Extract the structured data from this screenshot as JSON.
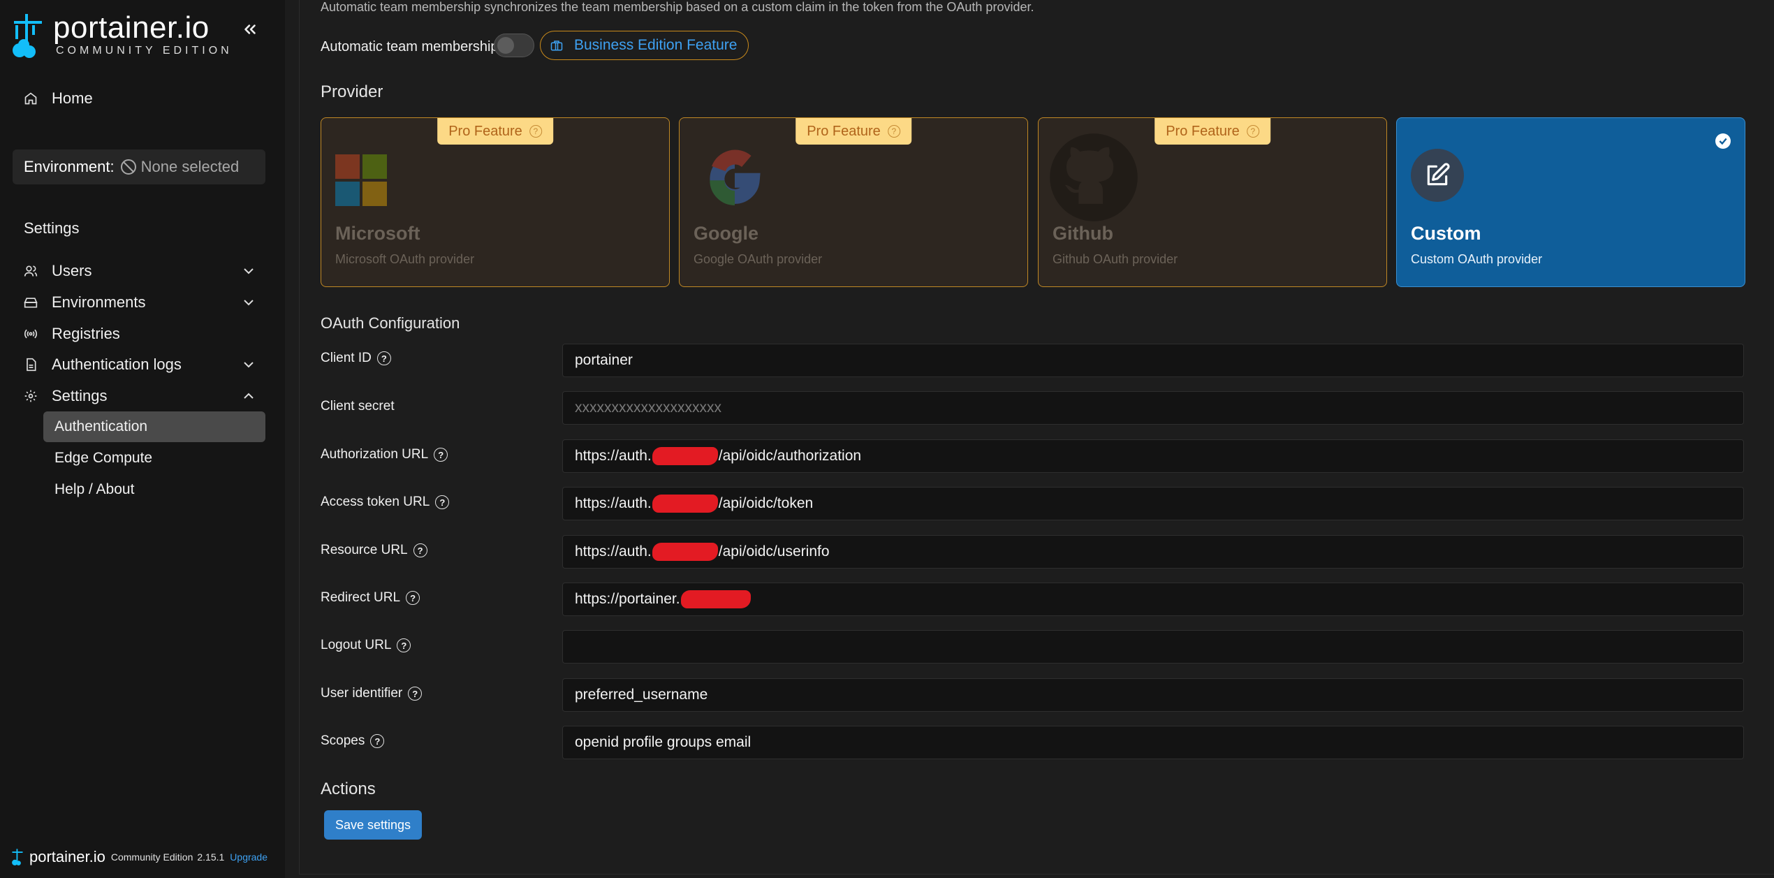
{
  "sidebar": {
    "logo_name": "portainer.io",
    "logo_sub": "COMMUNITY EDITION",
    "home": "Home",
    "environment_label": "Environment:",
    "environment_value": "None selected",
    "section_title": "Settings",
    "items": {
      "users": "Users",
      "environments": "Environments",
      "registries": "Registries",
      "auth_logs": "Authentication logs",
      "settings": "Settings"
    },
    "sub_items": {
      "authentication": "Authentication",
      "edge_compute": "Edge Compute",
      "help_about": "Help / About"
    },
    "footer": {
      "brand": "portainer.io",
      "edition": "Community Edition",
      "version": "2.15.1",
      "upgrade": "Upgrade"
    }
  },
  "main": {
    "description": "Automatic team membership synchronizes the team membership based on a custom claim in the token from the OAuth provider.",
    "team_membership_label": "Automatic team membership",
    "team_membership_enabled": false,
    "business_badge": "Business Edition Feature",
    "provider_heading": "Provider",
    "providers": [
      {
        "title": "Microsoft",
        "subtitle": "Microsoft OAuth provider",
        "badge": "Pro Feature"
      },
      {
        "title": "Google",
        "subtitle": "Google OAuth provider",
        "badge": "Pro Feature"
      },
      {
        "title": "Github",
        "subtitle": "Github OAuth provider",
        "badge": "Pro Feature"
      },
      {
        "title": "Custom",
        "subtitle": "Custom OAuth provider",
        "selected": true
      }
    ],
    "oauth_heading": "OAuth Configuration",
    "fields": {
      "client_id": {
        "label": "Client ID",
        "value": "portainer"
      },
      "client_secret": {
        "label": "Client secret",
        "placeholder": "xxxxxxxxxxxxxxxxxxxx"
      },
      "authorization_url": {
        "label": "Authorization URL",
        "prefix": "https://auth.",
        "suffix": "/api/oidc/authorization"
      },
      "access_token_url": {
        "label": "Access token URL",
        "prefix": "https://auth.",
        "suffix": "/api/oidc/token"
      },
      "resource_url": {
        "label": "Resource URL",
        "prefix": "https://auth.",
        "suffix": "/api/oidc/userinfo"
      },
      "redirect_url": {
        "label": "Redirect URL",
        "prefix": "https://portainer.",
        "suffix": ""
      },
      "logout_url": {
        "label": "Logout URL",
        "value": ""
      },
      "user_identifier": {
        "label": "User identifier",
        "value": "preferred_username"
      },
      "scopes": {
        "label": "Scopes",
        "value": "openid profile groups email"
      }
    },
    "actions_heading": "Actions",
    "save_button": "Save settings"
  },
  "colors": {
    "accent": "#3ea1f2",
    "selected_card": "#0f5e9a",
    "pro_badge": "#fcd986",
    "save_button": "#2f7fc9"
  }
}
